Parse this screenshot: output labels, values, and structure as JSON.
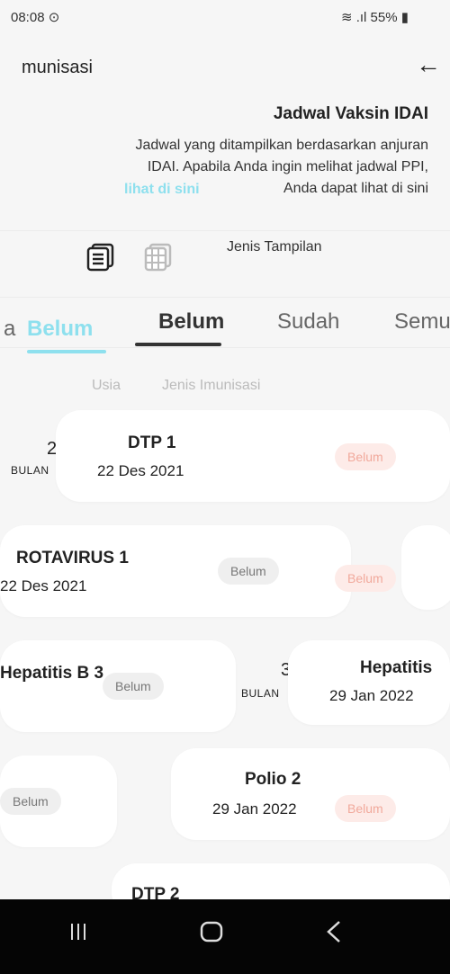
{
  "status": {
    "time": "08:08",
    "battery": "55%"
  },
  "header": {
    "title": "munisasi"
  },
  "info": {
    "heading": "Jadwal Vaksin IDAI",
    "description": "Jadwal yang ditampilkan berdasarkan anjuran IDAI. Apabila Anda ingin melihat jadwal PPI, Anda dapat lihat di sini",
    "left_fragment": "n ditampilkan berdasarkan anjuran\nIDAI. Apabila Anda ingin melihat jadwal PPI,\nAnda dapat lihat di sini",
    "link": "lihat di sini"
  },
  "view": {
    "label": "Jenis Tampilan"
  },
  "tabs": [
    {
      "label": "Belum"
    },
    {
      "label": "Sudah"
    },
    {
      "label": "Semu"
    }
  ],
  "tabs_ghost": {
    "a": "a",
    "active": "Belum"
  },
  "columns": {
    "age": "Usia",
    "type": "Jenis Imunisasi"
  },
  "entries": [
    {
      "age_num": "2",
      "age_unit": "BULAN",
      "title": "DTP 1",
      "date": "22 Des 2021",
      "status": "Belum"
    },
    {
      "title": "ROTAVIRUS 1",
      "date": "22 Des 2021",
      "status": "Belum",
      "status_pink": "Belum"
    },
    {
      "title": "Hepatitis B 3",
      "status": "Belum"
    },
    {
      "age_num": "3",
      "age_unit": "BULAN",
      "title": "Hepatitis",
      "date": "29 Jan 2022"
    },
    {
      "status": "Belum"
    },
    {
      "title": "Polio 2",
      "date": "29 Jan 2022",
      "status": "Belum"
    },
    {
      "title": "DTP 2"
    }
  ],
  "colors": {
    "accent": "#8ee0ee",
    "badge_pink_bg": "#fdebe8",
    "badge_pink_text": "#f1a99c"
  }
}
